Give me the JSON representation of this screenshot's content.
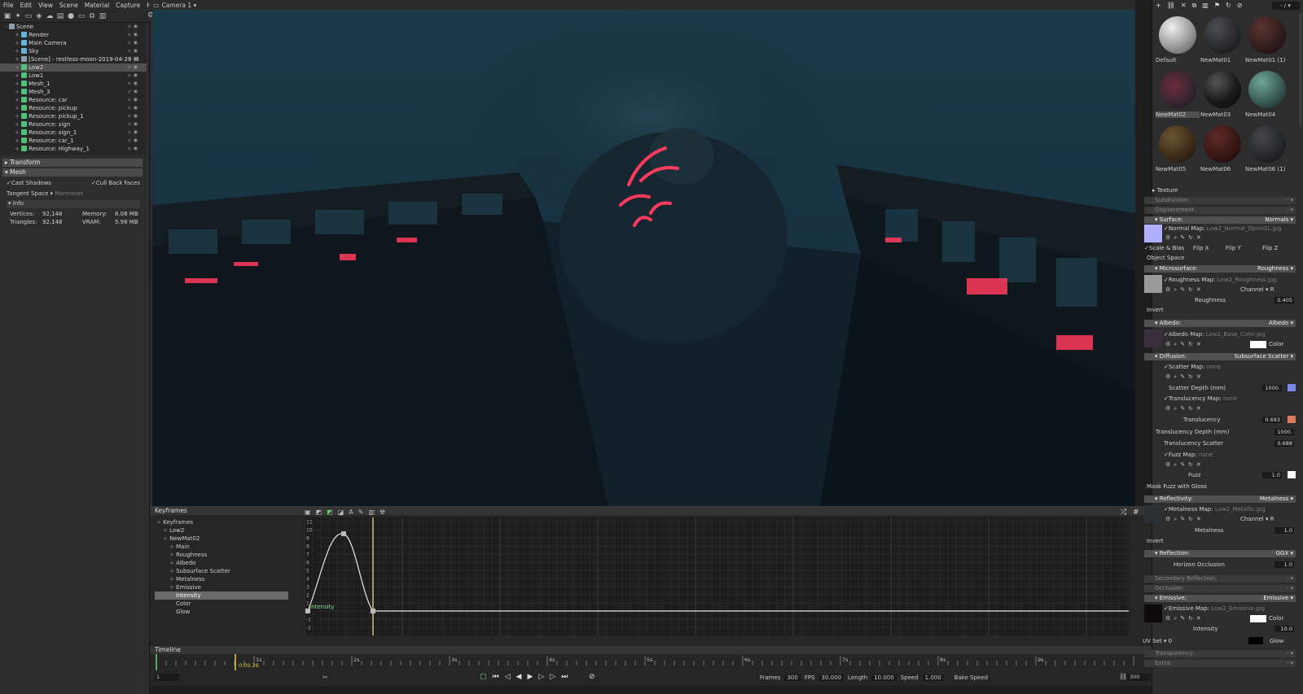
{
  "menu": [
    "File",
    "Edit",
    "View",
    "Scene",
    "Material",
    "Capture",
    "Help"
  ],
  "left_toolbar_icons": [
    "cube-icon",
    "light-icon",
    "camera-icon",
    "model-icon",
    "cloud-icon",
    "group-icon",
    "sphere-icon",
    "folder-icon",
    "duplicate-icon",
    "delete-icon"
  ],
  "viewport": {
    "camera_label": "Camera 1 ▾"
  },
  "scene_tree": [
    {
      "label": "Scene",
      "indent": 0,
      "color": "#8aa0b0"
    },
    {
      "label": "Render",
      "indent": 1,
      "color": "#5fb5dc"
    },
    {
      "label": "Main Camera",
      "indent": 1,
      "color": "#5fb5dc"
    },
    {
      "label": "Sky",
      "indent": 1,
      "color": "#5fb5dc"
    },
    {
      "label": "[Scene] - restless-moon-2019-04-29 (3",
      "indent": 1,
      "color": "#8aa0b0"
    },
    {
      "label": "Low2",
      "indent": 1,
      "color": "#4ec27a",
      "selected": true
    },
    {
      "label": "Low1",
      "indent": 1,
      "color": "#4ec27a"
    },
    {
      "label": "Mesh_1",
      "indent": 1,
      "color": "#4ec27a"
    },
    {
      "label": "Mesh_3",
      "indent": 1,
      "color": "#4ec27a"
    },
    {
      "label": "Resource: car",
      "indent": 1,
      "color": "#4ec27a"
    },
    {
      "label": "Resource: pickup",
      "indent": 1,
      "color": "#4ec27a"
    },
    {
      "label": "Resource: pickup_1",
      "indent": 1,
      "color": "#4ec27a"
    },
    {
      "label": "Resource: sign",
      "indent": 1,
      "color": "#4ec27a"
    },
    {
      "label": "Resource: sign_1",
      "indent": 1,
      "color": "#4ec27a"
    },
    {
      "label": "Resource: car_1",
      "indent": 1,
      "color": "#4ec27a"
    },
    {
      "label": "Resource: Highway_1",
      "indent": 1,
      "color": "#4ec27a"
    }
  ],
  "properties": {
    "transform": "Transform",
    "mesh": "Mesh",
    "cast_shadows": "Cast Shadows",
    "cull_back_faces": "Cull Back Faces",
    "tangent_space_label": "Tangent Space ▾",
    "tangent_space_value": "Marmoset",
    "info": "Info",
    "vertices_label": "Vertices:",
    "vertices": "92,148",
    "triangles_label": "Triangles:",
    "triangles": "92,148",
    "memory_label": "Memory:",
    "memory": "8.08 MB",
    "vram_label": "VRAM:",
    "vram": "5.98 MB"
  },
  "keyframes": {
    "title": "Keyframes",
    "tree": [
      {
        "label": "Keyframes",
        "indent": 0
      },
      {
        "label": "Low2",
        "indent": 1
      },
      {
        "label": "NewMat02",
        "indent": 1
      },
      {
        "label": "Main",
        "indent": 2
      },
      {
        "label": "Roughness",
        "indent": 2
      },
      {
        "label": "Albedo",
        "indent": 2
      },
      {
        "label": "Subsurface Scatter",
        "indent": 2
      },
      {
        "label": "Metalness",
        "indent": 2
      },
      {
        "label": "Emissive",
        "indent": 2
      },
      {
        "label": "Intensity",
        "indent": 3,
        "selected": true
      },
      {
        "label": "Color",
        "indent": 3
      },
      {
        "label": "Glow",
        "indent": 3
      }
    ],
    "y_ticks": [
      "11",
      "10",
      "9",
      "8",
      "7",
      "6",
      "5",
      "4",
      "3",
      "2",
      "1",
      "0",
      "-1",
      "-2"
    ],
    "curve_label": "Intensity"
  },
  "timeline": {
    "title": "Timeline",
    "marks": [
      "1s",
      "2s",
      "3s",
      "4s",
      "5s",
      "6s",
      "7s",
      "8s",
      "9s"
    ],
    "current_time": "0:00.26",
    "start_frame": "1",
    "frames_label": "Frames",
    "frames": "300",
    "fps_label": "FPS",
    "fps": "30.000",
    "length_label": "Length",
    "length": "10.000",
    "speed_label": "Speed",
    "speed": "1.000",
    "bake_speed": "Bake Speed",
    "end_frame": "300"
  },
  "materials": [
    {
      "label": "Default",
      "ball": "radial-gradient(circle at 35% 30%,#f0f0f0,#9a9a9a 55%,#4a4a4a)"
    },
    {
      "label": "NewMat01",
      "ball": "radial-gradient(circle at 35% 30%,#4a4e52,#25282b 60%,#111)"
    },
    {
      "label": "NewMat01 (1)",
      "ball": "radial-gradient(circle at 35% 30%,#5a3432,#2e1c1b 60%,#120a0a)"
    },
    {
      "label": "NewMat02",
      "ball": "radial-gradient(circle at 40% 40%,#6b2d3c,#3a2630 55%,#14121a)",
      "selected": true
    },
    {
      "label": "NewMat03",
      "ball": "radial-gradient(circle at 35% 30%,#555,#1a1a1a 55%,#050505)"
    },
    {
      "label": "NewMat04",
      "ball": "radial-gradient(circle at 35% 30%,#6fa59a,#35564f 60%,#13201e)"
    },
    {
      "label": "NewMat05",
      "ball": "radial-gradient(circle at 35% 30%,#6b5532,#3b2a18 60%,#150e08)"
    },
    {
      "label": "NewMat06",
      "ball": "radial-gradient(circle at 35% 30%,#5e2a26,#351614 60%,#140808)"
    },
    {
      "label": "NewMat06 (1)",
      "ball": "radial-gradient(circle at 35% 30%,#44484a,#24272a 60%,#0e0f10)"
    }
  ],
  "right_toolbar_icons": [
    "add-icon",
    "link-icon",
    "cross-icon",
    "duplicate-icon",
    "delete-icon",
    "tag-icon",
    "reset-icon",
    "block-icon"
  ],
  "right_top_label": "- / ▾",
  "material_panel": {
    "texture": "Texture",
    "subdivision": "Subdivision:",
    "displacement": "Displacement:",
    "surface": "Surface:",
    "surface_type": "Normals ▾",
    "normal_map_label": "Normal Map:",
    "normal_map_file": "Low2_Normal_OpenGL.jpg",
    "scale_bias": "Scale & Bias",
    "flip_x": "Flip X",
    "flip_y": "Flip Y",
    "flip_z": "Flip Z",
    "object_space": "Object Space",
    "microsurface": "Microsurface:",
    "microsurface_type": "Roughness ▾",
    "roughness_map_label": "Roughness Map:",
    "roughness_map_file": "Low2_Roughness.jpg",
    "channel_label": "Channel ▾",
    "channel_r": "R",
    "roughness_label": "Roughness",
    "roughness_value": "0.405",
    "invert": "Invert",
    "albedo": "Albedo:",
    "albedo_type": "Albedo ▾",
    "albedo_map_label": "Albedo Map:",
    "albedo_map_file": "Low2_Base_Color.jpg",
    "color_label": "Color",
    "diffusion": "Diffusion:",
    "diffusion_type": "Subsurface Scatter ▾",
    "scatter_map_label": "Scatter Map:",
    "none": "none",
    "scatter_depth_label": "Scatter Depth (mm)",
    "scatter_depth_value": "1000.",
    "translucency_map_label": "Translucency Map:",
    "translucency_label": "Translucency",
    "translucency_value": "0.693",
    "translucency_depth_label": "Translucency Depth (mm)",
    "translucency_depth_value": "1000.",
    "translucency_scatter_label": "Translucency Scatter",
    "translucency_scatter_value": "0.688",
    "fuzz_map_label": "Fuzz Map:",
    "fuzz_label": "Fuzz",
    "fuzz_value": "1.0",
    "mask_fuzz": "Mask Fuzz with Gloss",
    "reflectivity": "Reflectivity:",
    "reflectivity_type": "Metalness ▾",
    "metalness_map_label": "Metalness Map:",
    "metalness_map_file": "Low2_Metallic.jpg",
    "metalness_label": "Metalness",
    "metalness_value": "1.0",
    "reflection": "Reflection:",
    "reflection_type": "GGX ▾",
    "horizon_occlusion_label": "Horizon Occlusion",
    "horizon_occlusion_value": "1.0",
    "secondary_reflection": "Secondary Reflection:",
    "occlusion": "Occlusion:",
    "emissive": "Emissive:",
    "emissive_type": "Emissive ▾",
    "emissive_map_label": "Emissive Map:",
    "emissive_map_file": "Low2_Emissive.jpg",
    "intensity_label": "Intensity",
    "intensity_value": "10.0",
    "uv_set": "UV Set ▾ 0",
    "glow": "Glow",
    "transparency": "Transparency:",
    "extra": "Extra:",
    "dash": "- ▾"
  },
  "colors": {
    "accent_green": "#4ec27a",
    "neon": "#ff3a5c",
    "scatter_swatch": "#7a86e8",
    "translucency_swatch": "#e07a5a",
    "normal_swatch": "#b0b0ff"
  }
}
